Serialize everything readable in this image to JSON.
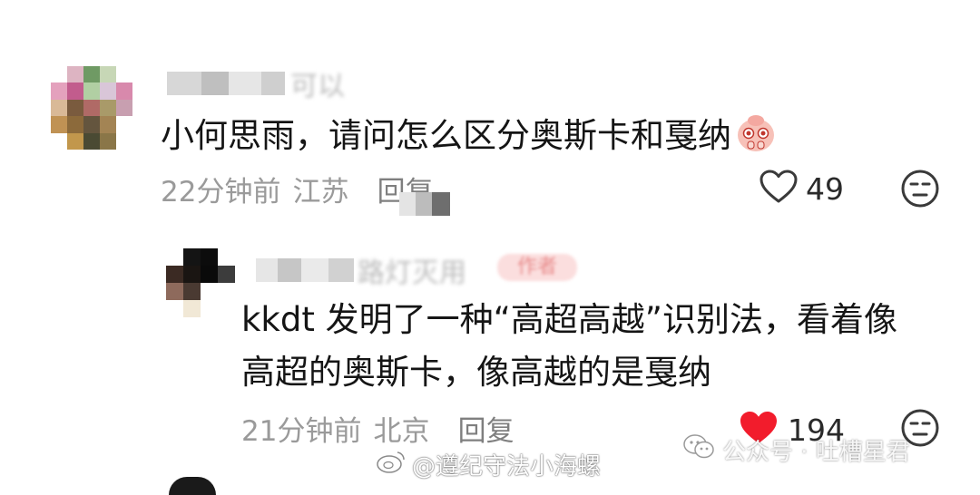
{
  "comment1": {
    "username_fragment": "可以",
    "text": "小何思雨，请问怎么区分奥斯卡和戛纳",
    "emoji": "pleading-face-emoji",
    "time": "22分钟前",
    "location": "江苏",
    "reply_label": "回复",
    "like_count": "49",
    "liked": false
  },
  "comment2": {
    "username_fragment": "路灯灭用",
    "badge": "作者",
    "text_line1": "kkdt 发明了一种“高超高越”识别法，看着像",
    "text_line2": "高超的奥斯卡，像高越的是戛纳",
    "time": "21分钟前",
    "location": "北京",
    "reply_label": "回复",
    "like_count": "194",
    "liked": true
  },
  "watermarks": {
    "weibo": "@遵纪守法小海螺",
    "wechat": "公众号 · 吐槽星君"
  },
  "colors": {
    "like_red": "#f21c2c",
    "meta_gray": "#9a9a9a",
    "icon_gray": "#3a3a3a"
  }
}
